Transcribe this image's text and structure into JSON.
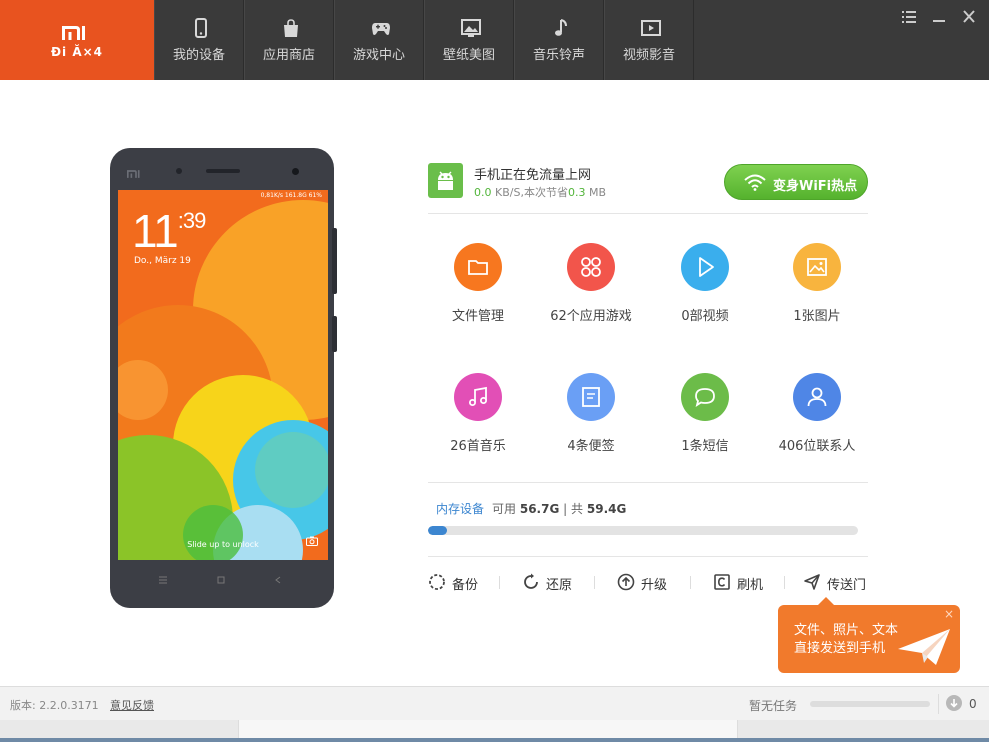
{
  "header": {
    "model": "Đi Ă×4",
    "nav": [
      {
        "label": "我的设备",
        "icon": "phone-icon"
      },
      {
        "label": "应用商店",
        "icon": "shopping-bag-icon"
      },
      {
        "label": "游戏中心",
        "icon": "gamepad-icon"
      },
      {
        "label": "壁纸美图",
        "icon": "picture-icon"
      },
      {
        "label": "音乐铃声",
        "icon": "music-note-icon"
      },
      {
        "label": "视频影音",
        "icon": "video-icon"
      }
    ]
  },
  "phone_screen": {
    "time_hour": "11",
    "time_min": ":39",
    "date": "Do., März 19",
    "status": "0,81K/s  161.8G  61%",
    "unlock_hint": "Slide up to unlock"
  },
  "network": {
    "title": "手机正在免流量上网",
    "speed": "0.0",
    "speed_unit": " KB/S,本次节省",
    "saved": "0.3",
    "saved_unit": " MB",
    "wifi_button": "变身WiFi热点"
  },
  "tiles": [
    {
      "label": "文件管理",
      "icon": "folder-icon",
      "color": "#f7771f"
    },
    {
      "label": "62个应用游戏",
      "icon": "apps-icon",
      "color": "#f2554b"
    },
    {
      "label": "0部视频",
      "icon": "play-icon",
      "color": "#3aaeed"
    },
    {
      "label": "1张图片",
      "icon": "image-icon",
      "color": "#f8b43e"
    },
    {
      "label": "26首音乐",
      "icon": "music-icon",
      "color": "#e24fb6"
    },
    {
      "label": "4条便签",
      "icon": "note-icon",
      "color": "#6a9ff5"
    },
    {
      "label": "1条短信",
      "icon": "message-icon",
      "color": "#6cbc49"
    },
    {
      "label": "406位联系人",
      "icon": "contact-icon",
      "color": "#4f86e6"
    }
  ],
  "storage": {
    "label": "内存设备",
    "available_label": "可用",
    "available": "56.7G",
    "sep": "|",
    "total_label": "共",
    "total": "59.4G",
    "used_fraction": 0.045
  },
  "actions": [
    {
      "label": "备份",
      "icon": "backup-icon"
    },
    {
      "label": "还原",
      "icon": "restore-icon"
    },
    {
      "label": "升级",
      "icon": "upgrade-icon"
    },
    {
      "label": "刷机",
      "icon": "flash-icon"
    },
    {
      "label": "传送门",
      "icon": "send-icon"
    }
  ],
  "popup": {
    "line1": "文件、照片、文本",
    "line2": "直接发送到手机",
    "close": "×"
  },
  "footer": {
    "version": "版本: 2.2.0.3171",
    "feedback": "意见反馈",
    "task_status": "暂无任务",
    "download_count": "0"
  },
  "colors": {
    "brand": "#e8531f",
    "topbar": "#3a3a3a",
    "accent_blue": "#3c86d0",
    "green": "#6abe4a"
  }
}
